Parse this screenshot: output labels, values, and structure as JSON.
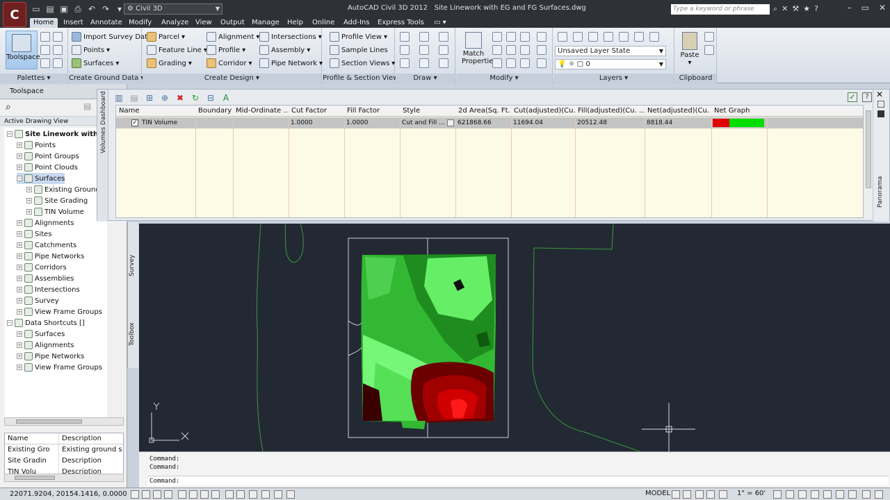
{
  "app": {
    "title": "AutoCAD Civil 3D 2012",
    "file": "Site Linework with EG and FG Surfaces.dwg",
    "workspace": "Civil 3D",
    "search_placeholder": "Type a keyword or phrase",
    "logo_letter": "C"
  },
  "menu_tabs": [
    "Home",
    "Insert",
    "Annotate",
    "Modify",
    "Analyze",
    "View",
    "Output",
    "Manage",
    "Help",
    "Online",
    "Add-Ins",
    "Express Tools"
  ],
  "ribbon": {
    "palettes": {
      "title": "Palettes",
      "toolspace": "Toolspace"
    },
    "ground": {
      "title": "Create Ground Data",
      "items": [
        "Import Survey Data",
        "Points",
        "Surfaces"
      ]
    },
    "design": {
      "title": "Create Design",
      "items": [
        "Parcel",
        "Feature Line",
        "Grading",
        "Alignment",
        "Profile",
        "Corridor",
        "Intersections",
        "Assembly",
        "Pipe Network"
      ]
    },
    "profile": {
      "title": "Profile & Section Views",
      "items": [
        "Profile View",
        "Sample Lines",
        "Section Views"
      ]
    },
    "draw": {
      "title": "Draw"
    },
    "modify": {
      "title": "Modify",
      "match": "Match",
      "properties": "Properties"
    },
    "layers": {
      "title": "Layers",
      "state": "Unsaved Layer State",
      "current": "0"
    },
    "clipboard": {
      "title": "Clipboard",
      "paste": "Paste"
    }
  },
  "toolspace": {
    "title": "Toolspace",
    "view": "Active Drawing View",
    "tree": [
      {
        "label": "Site Linework with EG",
        "level": 0,
        "bold": true
      },
      {
        "label": "Points",
        "level": 1
      },
      {
        "label": "Point Groups",
        "level": 1
      },
      {
        "label": "Point Clouds",
        "level": 1
      },
      {
        "label": "Surfaces",
        "level": 1,
        "selected": true
      },
      {
        "label": "Existing Ground",
        "level": 2
      },
      {
        "label": "Site Grading",
        "level": 2
      },
      {
        "label": "TIN Volume",
        "level": 2
      },
      {
        "label": "Alignments",
        "level": 1
      },
      {
        "label": "Sites",
        "level": 1
      },
      {
        "label": "Catchments",
        "level": 1
      },
      {
        "label": "Pipe Networks",
        "level": 1
      },
      {
        "label": "Corridors",
        "level": 1
      },
      {
        "label": "Assemblies",
        "level": 1
      },
      {
        "label": "Intersections",
        "level": 1
      },
      {
        "label": "Survey",
        "level": 1
      },
      {
        "label": "View Frame Groups",
        "level": 1
      },
      {
        "label": "Data Shortcuts []",
        "level": 0
      },
      {
        "label": "Surfaces",
        "level": 1
      },
      {
        "label": "Alignments",
        "level": 1
      },
      {
        "label": "Pipe Networks",
        "level": 1
      },
      {
        "label": "View Frame Groups",
        "level": 1
      }
    ],
    "side_tabs": [
      "Survey",
      "Toolbox"
    ],
    "list_headers": [
      "Name",
      "Description"
    ],
    "list_rows": [
      {
        "name": "Existing Gro",
        "desc": "Existing ground s"
      },
      {
        "name": "Site Gradin",
        "desc": "Description"
      },
      {
        "name": "TIN Volu",
        "desc": "Description"
      }
    ]
  },
  "dashboard": {
    "tab_label": "Volumes Dashboard",
    "columns": [
      "Name",
      "Boundary",
      "Mid-Ordinate ...",
      "Cut Factor",
      "Fill Factor",
      "Style",
      "2d Area(Sq. Ft.)",
      "Cut(adjusted)(Cu. ...",
      "Fill(adjusted)(Cu. ...",
      "Net(adjusted)(Cu. ...",
      "Net Graph"
    ],
    "row": {
      "name": "TIN Volume",
      "boundary": "",
      "mid_ordinate": "",
      "cut_factor": "1.0000",
      "fill_factor": "1.0000",
      "style": "Cut and Fill ...",
      "area": "621868.66",
      "cut": "11694.04",
      "fill": "20512.48",
      "net": "8818.44",
      "net_graph_fill_fraction": 0.67
    },
    "right_tab": "Panorama"
  },
  "command": {
    "lines": [
      "Command:",
      "Command:"
    ],
    "prompt": "Command:"
  },
  "status": {
    "coords": "22071.9204, 20154.1416, 0.0000",
    "model": "MODEL",
    "scale": "1\" = 60'"
  },
  "colors": {
    "cut": "#e00000",
    "fill": "#00dd00",
    "canvas": "#222933"
  }
}
